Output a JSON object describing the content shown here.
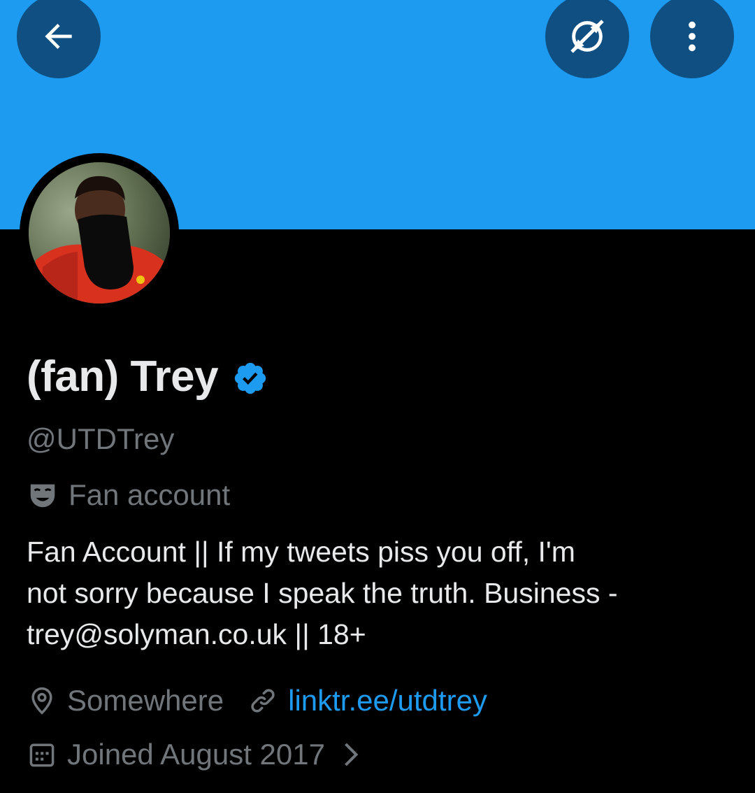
{
  "theme": {
    "banner_color": "#1d9bf0",
    "background": "#000000",
    "primary_text": "#e7e9ea",
    "secondary_text": "#71767b",
    "link_color": "#1d9bf0",
    "verified_color": "#1d9bf0",
    "overlay_button": "#0f4f82"
  },
  "header": {
    "back_icon": "arrow-left-icon",
    "explore_icon": "compass-slash-icon",
    "more_icon": "more-vertical-icon"
  },
  "profile": {
    "display_name": "(fan) Trey",
    "verified": true,
    "handle": "@UTDTrey",
    "category_icon": "theater-mask-icon",
    "category": "Fan account",
    "bio_lines": [
      "Fan Account || If my tweets piss you off, I'm",
      "not sorry because I speak the truth. Business -",
      "trey@solyman.co.uk || 18+"
    ],
    "location_icon": "location-pin-icon",
    "location": "Somewhere",
    "link_icon": "link-icon",
    "website": "linktr.ee/utdtrey",
    "joined_icon": "calendar-icon",
    "joined": "Joined August 2017"
  }
}
